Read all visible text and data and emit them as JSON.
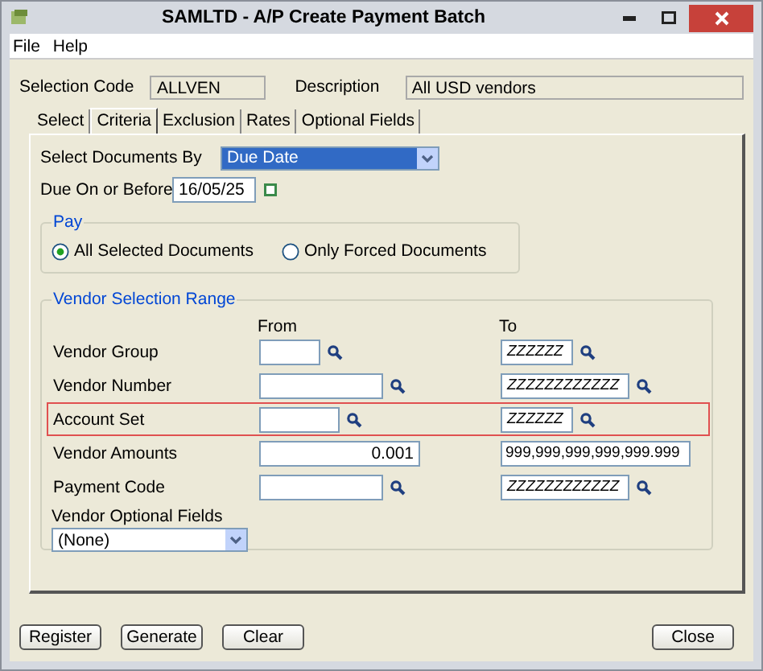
{
  "window": {
    "title": "SAMLTD - A/P Create Payment Batch"
  },
  "menu": [
    {
      "label": "File"
    },
    {
      "label": "Help"
    }
  ],
  "header": {
    "selection_code": {
      "label": "Selection Code",
      "value": "ALLVEN"
    },
    "description": {
      "label": "Description",
      "value": "All USD vendors"
    }
  },
  "tabs": [
    {
      "label": "Select",
      "selected": false
    },
    {
      "label": "Criteria",
      "selected": true
    },
    {
      "label": "Exclusion",
      "selected": false
    },
    {
      "label": "Rates",
      "selected": false
    },
    {
      "label": "Optional Fields",
      "selected": false
    }
  ],
  "criteria": {
    "select_documents_by": {
      "label": "Select Documents By",
      "value": "Due Date"
    },
    "due_on_or_before": {
      "label": "Due On or Before",
      "value": "16/05/25"
    },
    "pay": {
      "title": "Pay",
      "options": [
        {
          "label": "All Selected Documents",
          "selected": true
        },
        {
          "label": "Only Forced Documents",
          "selected": false
        }
      ]
    },
    "vendor_selection_range": {
      "title": "Vendor Selection Range",
      "from_header": "From",
      "to_header": "To",
      "rows": [
        {
          "kind": "lookup",
          "label": "Vendor Group",
          "from": "",
          "to": "ZZZZZZ",
          "highlighted": false
        },
        {
          "kind": "lookup",
          "label": "Vendor Number",
          "from": "",
          "to": "ZZZZZZZZZZZZ",
          "highlighted": false
        },
        {
          "kind": "lookup",
          "label": "Account Set",
          "from": "",
          "to": "ZZZZZZ",
          "highlighted": true
        },
        {
          "kind": "amount",
          "label": "Vendor Amounts",
          "from": "0.001",
          "to": "999,999,999,999,999.999",
          "highlighted": false
        },
        {
          "kind": "lookup",
          "label": "Payment Code",
          "from": "",
          "to": "ZZZZZZZZZZZZ",
          "highlighted": false
        }
      ],
      "optional_fields": {
        "label": "Vendor Optional Fields",
        "value": "(None)"
      }
    }
  },
  "buttons": [
    {
      "label": "Register"
    },
    {
      "label": "Generate"
    },
    {
      "label": "Clear"
    }
  ],
  "close_button": {
    "label": "Close"
  }
}
